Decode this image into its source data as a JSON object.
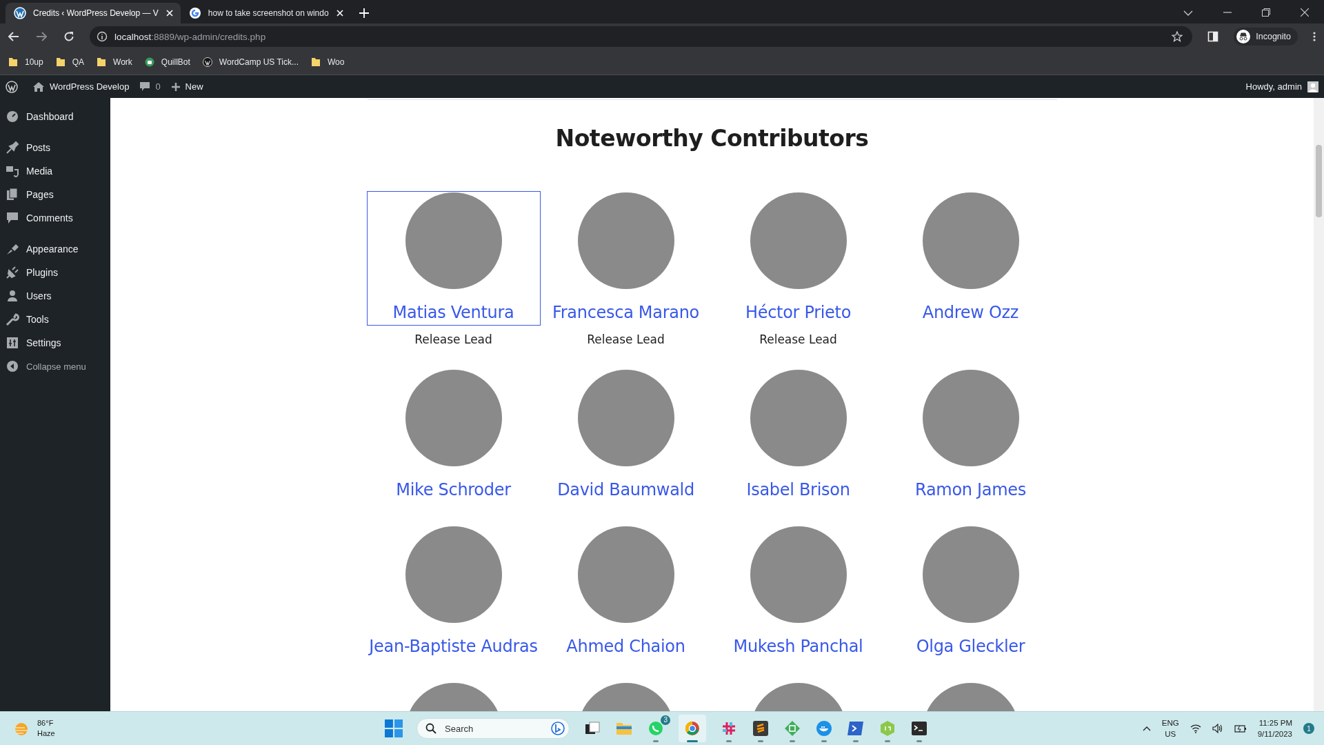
{
  "browser": {
    "tabs": [
      {
        "title": "Credits ‹ WordPress Develop — V",
        "selected": true
      },
      {
        "title": "how to take screenshot on windo",
        "selected": false
      }
    ],
    "address": {
      "host": "localhost",
      "path": ":8889/wp-admin/credits.php"
    },
    "profile": "Incognito",
    "bookmarks": [
      {
        "label": "10up",
        "kind": "folder"
      },
      {
        "label": "QA",
        "kind": "folder"
      },
      {
        "label": "Work",
        "kind": "folder"
      },
      {
        "label": "QuillBot",
        "kind": "site"
      },
      {
        "label": "WordCamp US Tick...",
        "kind": "wp"
      },
      {
        "label": "Woo",
        "kind": "folder"
      }
    ]
  },
  "admin_bar": {
    "site": "WordPress Develop",
    "comments": "0",
    "new": "New",
    "greeting": "Howdy, admin"
  },
  "sidebar": {
    "groups": [
      {
        "items": [
          "Dashboard"
        ]
      },
      {
        "items": [
          "Posts",
          "Media",
          "Pages",
          "Comments"
        ]
      },
      {
        "items": [
          "Appearance",
          "Plugins",
          "Users",
          "Tools",
          "Settings"
        ]
      }
    ],
    "collapse": "Collapse menu"
  },
  "content": {
    "heading": "Noteworthy Contributors",
    "contributors": [
      {
        "name": "Matias Ventura",
        "role": "Release Lead",
        "focused": true
      },
      {
        "name": "Francesca Marano",
        "role": "Release Lead",
        "focused": false
      },
      {
        "name": "Héctor Prieto",
        "role": "Release Lead",
        "focused": false
      },
      {
        "name": "Andrew Ozz",
        "focused": false
      },
      {
        "name": "Mike Schroder",
        "focused": false
      },
      {
        "name": "David Baumwald",
        "focused": false
      },
      {
        "name": "Isabel Brison",
        "focused": false
      },
      {
        "name": "Ramon James",
        "focused": false
      },
      {
        "name": "Jean-Baptiste Audras",
        "focused": false
      },
      {
        "name": "Ahmed Chaion",
        "focused": false
      },
      {
        "name": "Mukesh Panchal",
        "focused": false
      },
      {
        "name": "Olga Gleckler",
        "focused": false
      },
      {
        "focused": false
      },
      {
        "focused": false
      },
      {
        "focused": false
      },
      {
        "focused": false
      }
    ]
  },
  "taskbar": {
    "weather": {
      "temp": "86°F",
      "condition": "Haze"
    },
    "search": "Search",
    "whatsapp_badge": "3",
    "language": {
      "top": "ENG",
      "bottom": "US"
    },
    "time": "11:25 PM",
    "date": "9/11/2023",
    "notifications": "1"
  }
}
